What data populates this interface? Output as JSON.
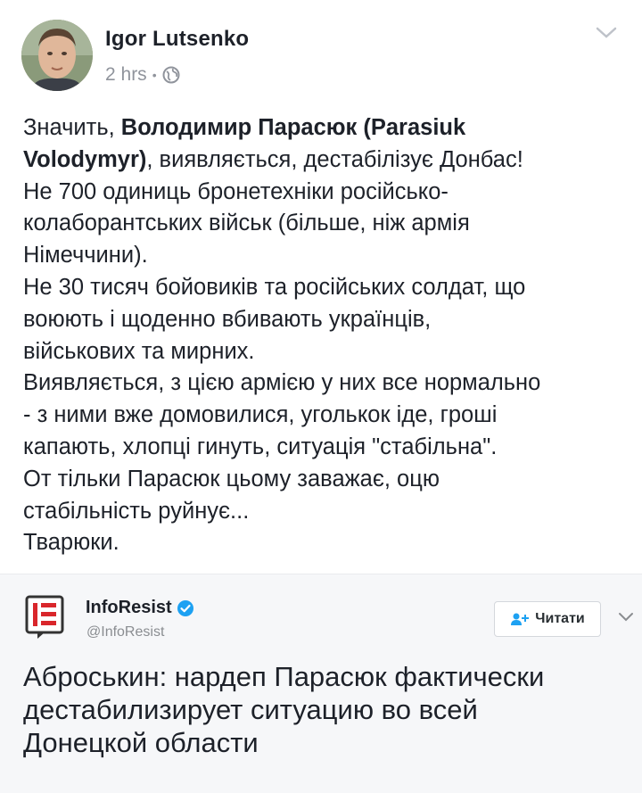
{
  "post": {
    "author": "Igor Lutsenko",
    "time": "2 hrs",
    "separator": "•",
    "privacy_icon": "globe-icon",
    "menu_icon": "chevron-down-icon",
    "body": {
      "line1_prefix": "Значить, ",
      "line1_bold": "Володимир Парасюк (Parasiuk",
      "line2_bold": "Volodymyr)",
      "line2_rest": ", виявляється, дестабілізує Донбас!",
      "line3": "Не 700 одиниць бронетехніки російсько-",
      "line4": "колаборантських військ (більше, ніж армія",
      "line5": "Німеччини).",
      "line6": "Не 30 тисяч бойовиків та російських солдат, що",
      "line7": "воюють і щоденно вбивають українців,",
      "line8": "військових та мирних.",
      "line9": "Виявляється, з цією армією у них все нормально",
      "line10": "- з ними вже домовилися, уголькок іде, гроші",
      "line11": "капають, хлопці гинуть, ситуація \"стабільна\".",
      "line12": "От тільки Парасюк цьому заважає, оцю",
      "line13": "стабільність руйнує...",
      "line14": "Тварюки."
    }
  },
  "embed": {
    "account_name": "InfoResist",
    "handle": "@InfoResist",
    "verified_icon": "verified-check-icon",
    "follow_label": "Читати",
    "follow_icon": "add-person-icon",
    "menu_icon": "chevron-down-icon",
    "tweet_lines": [
      "Аброськин: нардеп Парасюк фактически",
      "дестабилизирует ситуацию во всей",
      "Донецкой области"
    ]
  },
  "colors": {
    "text": "#1d2129",
    "meta": "#90949c",
    "verified": "#1da1f2",
    "logo_red": "#d9262b",
    "follow_icon": "#1da1f2"
  }
}
